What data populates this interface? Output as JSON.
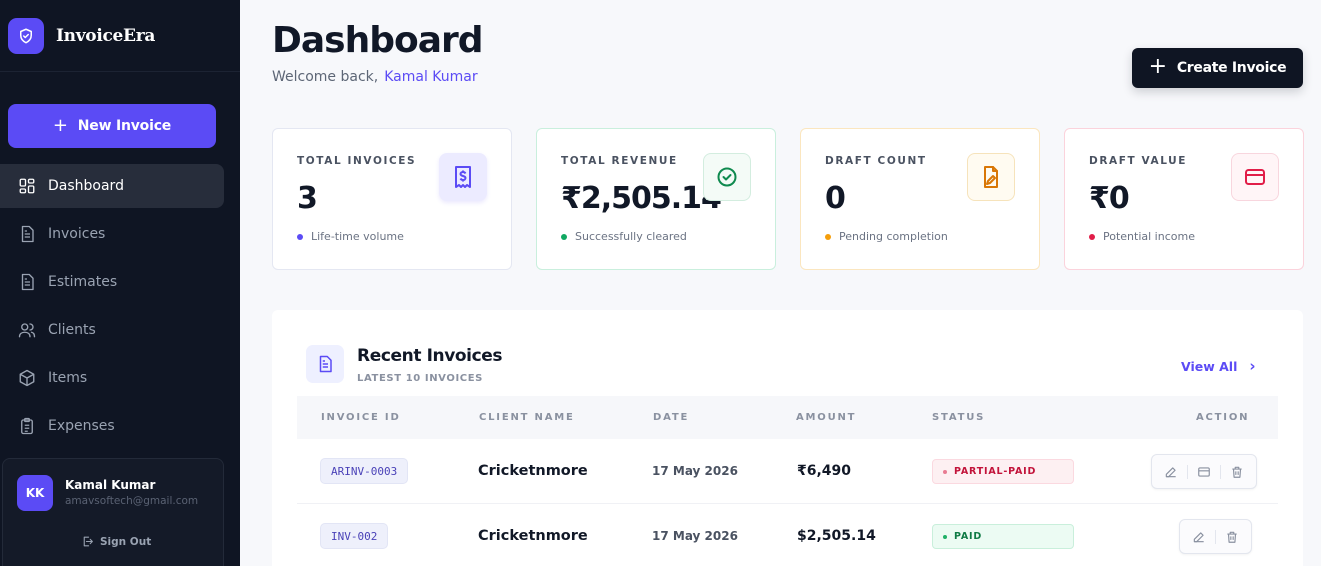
{
  "app": {
    "name": "InvoiceEra"
  },
  "sidebar": {
    "new_invoice_label": "New Invoice",
    "items": [
      {
        "label": "Dashboard",
        "icon": "grid-icon",
        "active": true
      },
      {
        "label": "Invoices",
        "icon": "document-icon"
      },
      {
        "label": "Estimates",
        "icon": "document-icon"
      },
      {
        "label": "Clients",
        "icon": "users-icon"
      },
      {
        "label": "Items",
        "icon": "box-icon"
      },
      {
        "label": "Expenses",
        "icon": "clipboard-icon"
      }
    ],
    "user": {
      "initials": "KK",
      "name": "Kamal Kumar",
      "email": "amavsoftech@gmail.com",
      "signout_label": "Sign Out"
    }
  },
  "header": {
    "title": "Dashboard",
    "welcome": "Welcome back,",
    "user_name": "Kamal Kumar",
    "create_label": "Create Invoice"
  },
  "stats": [
    {
      "label": "TOTAL INVOICES",
      "value": "3",
      "sub": "Life-time volume",
      "color": "#5b4bf5",
      "icon": "receipt-icon"
    },
    {
      "label": "TOTAL REVENUE",
      "value": "₹2,505.14",
      "sub": "Successfully cleared",
      "color": "#10a862",
      "icon": "check-circle-icon"
    },
    {
      "label": "DRAFT COUNT",
      "value": "0",
      "sub": "Pending completion",
      "color": "#f59e0b",
      "icon": "file-edit-icon"
    },
    {
      "label": "DRAFT VALUE",
      "value": "₹0",
      "sub": "Potential income",
      "color": "#e11d48",
      "icon": "card-icon"
    }
  ],
  "recent": {
    "title": "Recent Invoices",
    "subtitle": "LATEST 10 INVOICES",
    "view_all": "View All",
    "columns": [
      "INVOICE ID",
      "CLIENT NAME",
      "DATE",
      "AMOUNT",
      "STATUS",
      "ACTION"
    ],
    "rows": [
      {
        "id": "ARINV-0003",
        "client": "Cricketnmore",
        "date": "17 May 2026",
        "amount": "₹6,490",
        "status": "PARTIAL-PAID"
      },
      {
        "id": "INV-002",
        "client": "Cricketnmore",
        "date": "17 May 2026",
        "amount": "$2,505.14",
        "status": "PAID"
      }
    ]
  },
  "colors": {
    "accent": "#5b4bf5",
    "sidebar": "#0f1523"
  }
}
